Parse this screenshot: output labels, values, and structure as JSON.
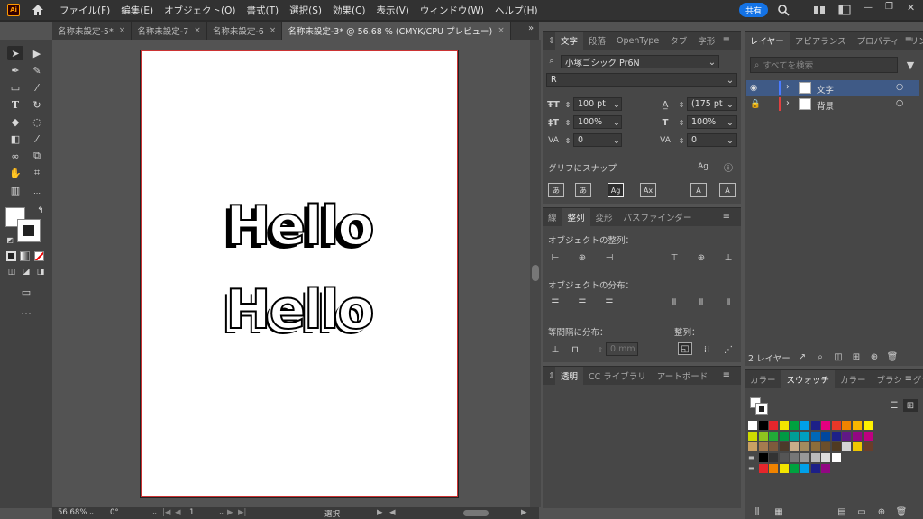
{
  "app": {
    "logo": "Ai",
    "share_label": "共有"
  },
  "menu": [
    "ファイル(F)",
    "編集(E)",
    "オブジェクト(O)",
    "書式(T)",
    "選択(S)",
    "効果(C)",
    "表示(V)",
    "ウィンドウ(W)",
    "ヘルプ(H)"
  ],
  "tabs": [
    {
      "label": "名称未設定-5*",
      "active": false
    },
    {
      "label": "名称未設定-7",
      "active": false
    },
    {
      "label": "名称未設定-6",
      "active": false
    },
    {
      "label": "名称未設定-3* @ 56.68 % (CMYK/CPU プレビュー)",
      "active": true
    }
  ],
  "canvas": {
    "text1": "Hello",
    "text2": "Hello"
  },
  "status": {
    "zoom": "56.68%",
    "rotation": "0°",
    "page": "1",
    "mode": "選択"
  },
  "char_panel": {
    "tabs": [
      "文字",
      "段落",
      "OpenType",
      "タブ",
      "字形"
    ],
    "font_family": "小塚ゴシック Pr6N",
    "font_style": "R",
    "font_size": "100 pt",
    "leading": "(175 pt",
    "vscale": "100%",
    "hscale": "100%",
    "kerning": "0",
    "tracking": "0",
    "snap_label": "グリフにスナップ"
  },
  "align_panel": {
    "tabs": [
      "線",
      "整列",
      "変形",
      "パスファインダー"
    ],
    "align_objects": "オブジェクトの整列：",
    "distribute_objects": "オブジェクトの分布：",
    "distribute_spacing": "等間隔に分布：",
    "align_to": "整列：",
    "spacing_value": "0 mm"
  },
  "transparency_panel": {
    "tabs": [
      "透明",
      "CC ライブラリ",
      "アートボード"
    ]
  },
  "layers_panel": {
    "tabs": [
      "レイヤー",
      "アピアランス",
      "プロパティ",
      "リンク"
    ],
    "search_placeholder": "すべてを検索",
    "layers": [
      {
        "name": "文字",
        "color": "#4a7bff",
        "selected": true
      },
      {
        "name": "背景",
        "color": "#e04040",
        "selected": false
      }
    ],
    "count": "2 レイヤー"
  },
  "swatch_panel": {
    "tabs": [
      "カラー",
      "スウォッチ",
      "カラー",
      "ブラシ",
      "グラデ"
    ]
  }
}
